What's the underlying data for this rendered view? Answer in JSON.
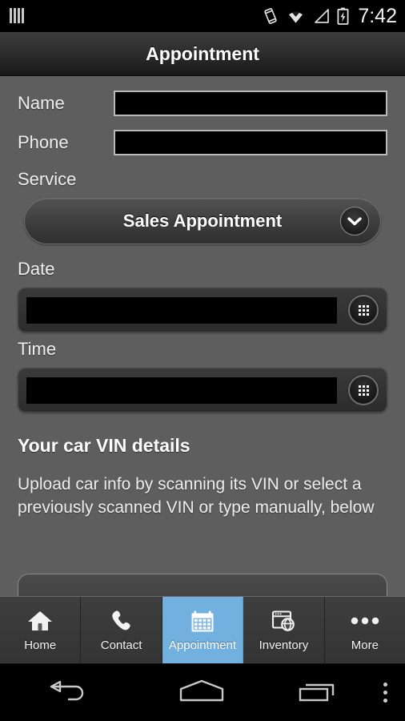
{
  "status_bar": {
    "left_icon": "signal-bars-icon",
    "icons": [
      "vibrate-icon",
      "wifi-icon",
      "cell-signal-icon",
      "battery-charging-icon"
    ],
    "clock": "7:42"
  },
  "title_bar": {
    "title": "Appointment"
  },
  "form": {
    "name": {
      "label": "Name",
      "value": "",
      "placeholder": ""
    },
    "phone": {
      "label": "Phone",
      "value": "",
      "placeholder": ""
    },
    "service": {
      "label": "Service",
      "selected": "Sales Appointment",
      "options": [
        "Sales Appointment"
      ],
      "chevron": "chevron-down-icon"
    },
    "date": {
      "label": "Date",
      "value": "",
      "placeholder": "",
      "picker_icon": "calendar-grid-icon"
    },
    "time": {
      "label": "Time",
      "value": "",
      "placeholder": "",
      "picker_icon": "clock-grid-icon"
    }
  },
  "vin_section": {
    "heading": "Your car VIN details",
    "description": "Upload car info by scanning its VIN or select a previously scanned VIN or type manually, below"
  },
  "tab_bar": {
    "active_index": 2,
    "active_color": "#72b1df",
    "tabs": [
      {
        "label": "Home",
        "icon": "home-icon"
      },
      {
        "label": "Contact",
        "icon": "phone-icon"
      },
      {
        "label": "Appointment",
        "icon": "calendar-icon"
      },
      {
        "label": "Inventory",
        "icon": "browser-globe-icon"
      },
      {
        "label": "More",
        "icon": "ellipsis-icon"
      }
    ]
  },
  "nav_bar": {
    "buttons": [
      {
        "name": "back",
        "icon": "back-arrow-icon"
      },
      {
        "name": "home",
        "icon": "home-pentagon-icon"
      },
      {
        "name": "recents",
        "icon": "recents-icon"
      },
      {
        "name": "menu",
        "icon": "overflow-menu-icon"
      }
    ]
  }
}
